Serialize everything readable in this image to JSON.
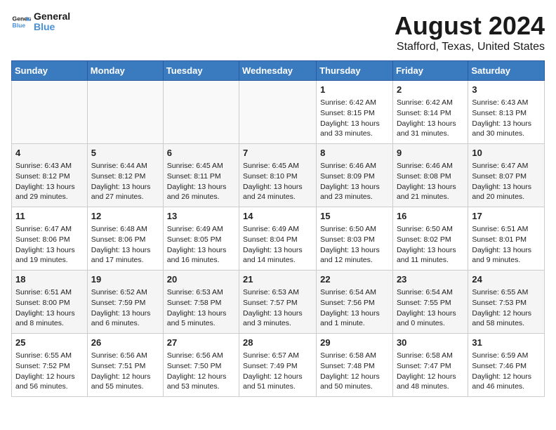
{
  "header": {
    "logo_line1": "General",
    "logo_line2": "Blue",
    "main_title": "August 2024",
    "subtitle": "Stafford, Texas, United States"
  },
  "days_of_week": [
    "Sunday",
    "Monday",
    "Tuesday",
    "Wednesday",
    "Thursday",
    "Friday",
    "Saturday"
  ],
  "weeks": [
    [
      {
        "day": "",
        "info": ""
      },
      {
        "day": "",
        "info": ""
      },
      {
        "day": "",
        "info": ""
      },
      {
        "day": "",
        "info": ""
      },
      {
        "day": "1",
        "info": "Sunrise: 6:42 AM\nSunset: 8:15 PM\nDaylight: 13 hours\nand 33 minutes."
      },
      {
        "day": "2",
        "info": "Sunrise: 6:42 AM\nSunset: 8:14 PM\nDaylight: 13 hours\nand 31 minutes."
      },
      {
        "day": "3",
        "info": "Sunrise: 6:43 AM\nSunset: 8:13 PM\nDaylight: 13 hours\nand 30 minutes."
      }
    ],
    [
      {
        "day": "4",
        "info": "Sunrise: 6:43 AM\nSunset: 8:12 PM\nDaylight: 13 hours\nand 29 minutes."
      },
      {
        "day": "5",
        "info": "Sunrise: 6:44 AM\nSunset: 8:12 PM\nDaylight: 13 hours\nand 27 minutes."
      },
      {
        "day": "6",
        "info": "Sunrise: 6:45 AM\nSunset: 8:11 PM\nDaylight: 13 hours\nand 26 minutes."
      },
      {
        "day": "7",
        "info": "Sunrise: 6:45 AM\nSunset: 8:10 PM\nDaylight: 13 hours\nand 24 minutes."
      },
      {
        "day": "8",
        "info": "Sunrise: 6:46 AM\nSunset: 8:09 PM\nDaylight: 13 hours\nand 23 minutes."
      },
      {
        "day": "9",
        "info": "Sunrise: 6:46 AM\nSunset: 8:08 PM\nDaylight: 13 hours\nand 21 minutes."
      },
      {
        "day": "10",
        "info": "Sunrise: 6:47 AM\nSunset: 8:07 PM\nDaylight: 13 hours\nand 20 minutes."
      }
    ],
    [
      {
        "day": "11",
        "info": "Sunrise: 6:47 AM\nSunset: 8:06 PM\nDaylight: 13 hours\nand 19 minutes."
      },
      {
        "day": "12",
        "info": "Sunrise: 6:48 AM\nSunset: 8:06 PM\nDaylight: 13 hours\nand 17 minutes."
      },
      {
        "day": "13",
        "info": "Sunrise: 6:49 AM\nSunset: 8:05 PM\nDaylight: 13 hours\nand 16 minutes."
      },
      {
        "day": "14",
        "info": "Sunrise: 6:49 AM\nSunset: 8:04 PM\nDaylight: 13 hours\nand 14 minutes."
      },
      {
        "day": "15",
        "info": "Sunrise: 6:50 AM\nSunset: 8:03 PM\nDaylight: 13 hours\nand 12 minutes."
      },
      {
        "day": "16",
        "info": "Sunrise: 6:50 AM\nSunset: 8:02 PM\nDaylight: 13 hours\nand 11 minutes."
      },
      {
        "day": "17",
        "info": "Sunrise: 6:51 AM\nSunset: 8:01 PM\nDaylight: 13 hours\nand 9 minutes."
      }
    ],
    [
      {
        "day": "18",
        "info": "Sunrise: 6:51 AM\nSunset: 8:00 PM\nDaylight: 13 hours\nand 8 minutes."
      },
      {
        "day": "19",
        "info": "Sunrise: 6:52 AM\nSunset: 7:59 PM\nDaylight: 13 hours\nand 6 minutes."
      },
      {
        "day": "20",
        "info": "Sunrise: 6:53 AM\nSunset: 7:58 PM\nDaylight: 13 hours\nand 5 minutes."
      },
      {
        "day": "21",
        "info": "Sunrise: 6:53 AM\nSunset: 7:57 PM\nDaylight: 13 hours\nand 3 minutes."
      },
      {
        "day": "22",
        "info": "Sunrise: 6:54 AM\nSunset: 7:56 PM\nDaylight: 13 hours\nand 1 minute."
      },
      {
        "day": "23",
        "info": "Sunrise: 6:54 AM\nSunset: 7:55 PM\nDaylight: 13 hours\nand 0 minutes."
      },
      {
        "day": "24",
        "info": "Sunrise: 6:55 AM\nSunset: 7:53 PM\nDaylight: 12 hours\nand 58 minutes."
      }
    ],
    [
      {
        "day": "25",
        "info": "Sunrise: 6:55 AM\nSunset: 7:52 PM\nDaylight: 12 hours\nand 56 minutes."
      },
      {
        "day": "26",
        "info": "Sunrise: 6:56 AM\nSunset: 7:51 PM\nDaylight: 12 hours\nand 55 minutes."
      },
      {
        "day": "27",
        "info": "Sunrise: 6:56 AM\nSunset: 7:50 PM\nDaylight: 12 hours\nand 53 minutes."
      },
      {
        "day": "28",
        "info": "Sunrise: 6:57 AM\nSunset: 7:49 PM\nDaylight: 12 hours\nand 51 minutes."
      },
      {
        "day": "29",
        "info": "Sunrise: 6:58 AM\nSunset: 7:48 PM\nDaylight: 12 hours\nand 50 minutes."
      },
      {
        "day": "30",
        "info": "Sunrise: 6:58 AM\nSunset: 7:47 PM\nDaylight: 12 hours\nand 48 minutes."
      },
      {
        "day": "31",
        "info": "Sunrise: 6:59 AM\nSunset: 7:46 PM\nDaylight: 12 hours\nand 46 minutes."
      }
    ]
  ]
}
